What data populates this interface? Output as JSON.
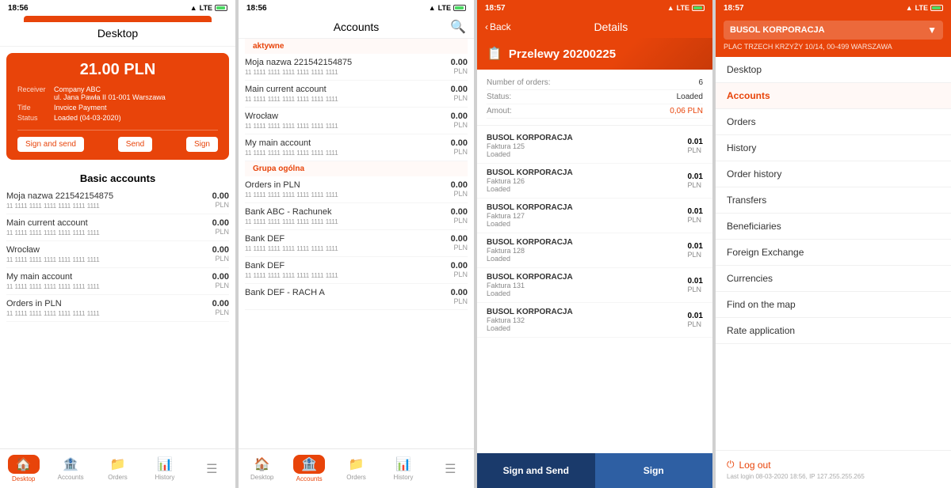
{
  "screens": [
    {
      "id": "screen1",
      "statusBar": {
        "time": "18:56",
        "signal": "↑",
        "lte": "LTE",
        "battery": "🔋"
      },
      "header": {
        "title": "Desktop"
      },
      "card": {
        "amount": "21.00 PLN",
        "receiver_label": "Receiver",
        "receiver_value": "Company ABC\nul. Jana Pawła II 01-001 Warszawa",
        "title_label": "Title",
        "title_value": "Invoice Payment",
        "status_label": "Status",
        "status_value": "Loaded (04-03-2020)",
        "btn_sign_send": "Sign and send",
        "btn_send": "Send",
        "btn_sign": "Sign"
      },
      "basicAccountsTitle": "Basic accounts",
      "accounts": [
        {
          "name": "Moja nazwa 221542154875",
          "number": "11 1111 1111 1111 1111 1111 1111",
          "amount": "0.00",
          "currency": "PLN"
        },
        {
          "name": "Main current account",
          "number": "11 1111 1111 1111 1111 1111 1111",
          "amount": "0.00",
          "currency": "PLN"
        },
        {
          "name": "Wrocław",
          "number": "11 1111 1111 1111 1111 1111 1111",
          "amount": "0.00",
          "currency": "PLN"
        },
        {
          "name": "My main account",
          "number": "11 1111 1111 1111 1111 1111 1111",
          "amount": "0.00",
          "currency": "PLN"
        },
        {
          "name": "Orders in PLN",
          "number": "11 1111 1111 1111 1111 1111 1111",
          "amount": "0.00",
          "currency": "PLN"
        }
      ],
      "nav": [
        {
          "icon": "🏠",
          "label": "Desktop",
          "active": true
        },
        {
          "icon": "🏦",
          "label": "Accounts",
          "active": false
        },
        {
          "icon": "📁",
          "label": "Orders",
          "active": false
        },
        {
          "icon": "📊",
          "label": "History",
          "active": false
        }
      ]
    },
    {
      "id": "screen2",
      "statusBar": {
        "time": "18:56",
        "signal": "↑",
        "lte": "LTE"
      },
      "header": {
        "title": "Accounts"
      },
      "groups": [
        {
          "label": "aktywne",
          "accounts": [
            {
              "name": "Moja nazwa 221542154875",
              "number": "11 1111 1111 1111 1111 1111 1111",
              "amount": "0.00",
              "currency": "PLN"
            },
            {
              "name": "Main current account",
              "number": "11 1111 1111 1111 1111 1111 1111",
              "amount": "0.00",
              "currency": "PLN"
            },
            {
              "name": "Wrocław",
              "number": "11 1111 1111 1111 1111 1111 1111",
              "amount": "0.00",
              "currency": "PLN"
            },
            {
              "name": "My main account",
              "number": "11 1111 1111 1111 1111 1111 1111",
              "amount": "0.00",
              "currency": "PLN"
            }
          ]
        },
        {
          "label": "Grupa ogólna",
          "accounts": [
            {
              "name": "Orders in PLN",
              "number": "11 1111 1111 1111 1111 1111 1111",
              "amount": "0.00",
              "currency": "PLN"
            },
            {
              "name": "Bank ABC - Rachunek",
              "number": "11 1111 1111 1111 1111 1111 1111",
              "amount": "0.00",
              "currency": "PLN"
            },
            {
              "name": "Bank DEF",
              "number": "11 1111 1111 1111 1111 1111 1111",
              "amount": "0.00",
              "currency": "PLN"
            },
            {
              "name": "Bank DEF",
              "number": "11 1111 1111 1111 1111 1111 1111",
              "amount": "0.00",
              "currency": "PLN"
            },
            {
              "name": "Bank DEF - RACH A",
              "number": "",
              "amount": "0.00",
              "currency": "PLN"
            }
          ]
        }
      ],
      "nav": [
        {
          "icon": "🏠",
          "label": "Desktop",
          "active": false
        },
        {
          "icon": "🏦",
          "label": "Accounts",
          "active": true
        },
        {
          "icon": "📁",
          "label": "Orders",
          "active": false
        },
        {
          "icon": "📊",
          "label": "History",
          "active": false
        }
      ]
    },
    {
      "id": "screen3",
      "statusBar": {
        "time": "18:57",
        "signal": "↑",
        "lte": "LTE"
      },
      "header": {
        "back": "Back",
        "title": "Details"
      },
      "hero": {
        "icon": "📋",
        "title": "Przelewy 20200225"
      },
      "details": [
        {
          "label": "Number of orders:",
          "value": "6"
        },
        {
          "label": "Status:",
          "value": "Loaded"
        },
        {
          "label": "Amout:",
          "value": "0,06 PLN"
        }
      ],
      "transfers": [
        {
          "company": "BUSOL KORPORACJA",
          "invoice": "Faktura 125",
          "status": "Loaded",
          "amount": "0.01",
          "currency": "PLN"
        },
        {
          "company": "BUSOL KORPORACJA",
          "invoice": "Faktura 126",
          "status": "Loaded",
          "amount": "0.01",
          "currency": "PLN"
        },
        {
          "company": "BUSOL KORPORACJA",
          "invoice": "Faktura 127",
          "status": "Loaded",
          "amount": "0.01",
          "currency": "PLN"
        },
        {
          "company": "BUSOL KORPORACJA",
          "invoice": "Faktura 128",
          "status": "Loaded",
          "amount": "0.01",
          "currency": "PLN"
        },
        {
          "company": "BUSOL KORPORACJA",
          "invoice": "Faktura 131",
          "status": "Loaded",
          "amount": "0.01",
          "currency": "PLN"
        },
        {
          "company": "BUSOL KORPORACJA",
          "invoice": "Faktura 132",
          "status": "Loaded",
          "amount": "0.01",
          "currency": "PLN"
        }
      ],
      "actions": {
        "sign_send": "Sign and Send",
        "sign": "Sign"
      }
    },
    {
      "id": "screen4",
      "statusBar": {
        "time": "18:57",
        "signal": "↑",
        "lte": "LTE"
      },
      "accountSelector": {
        "name": "BUSOL KORPORACJA",
        "address": "PLAC TRZECH KRZYŻY 10/14, 00-499 WARSZAWA"
      },
      "menuItems": [
        {
          "label": "Desktop",
          "active": false
        },
        {
          "label": "Accounts",
          "active": true
        },
        {
          "label": "Orders",
          "active": false
        },
        {
          "label": "History",
          "active": false
        },
        {
          "label": "Order history",
          "active": false
        },
        {
          "label": "Transfers",
          "active": false
        },
        {
          "label": "Beneficiaries",
          "active": false
        },
        {
          "label": "Foreign Exchange",
          "active": false
        },
        {
          "label": "Currencies",
          "active": false
        },
        {
          "label": "Find on the map",
          "active": false
        },
        {
          "label": "Rate application",
          "active": false
        }
      ],
      "logout": {
        "label": "Log out",
        "lastLogin": "Last login 08-03-2020 18:56, IP 127.255.255.265"
      }
    }
  ]
}
